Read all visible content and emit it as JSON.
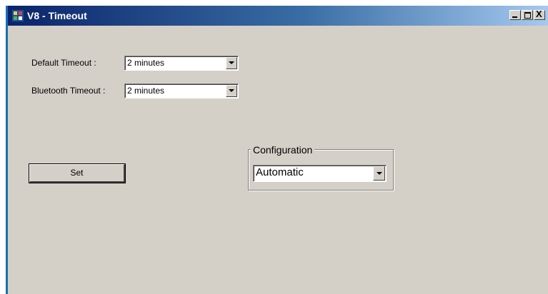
{
  "window": {
    "title": "V8 - Timeout",
    "controls": {
      "minimize": "_",
      "maximize": "□",
      "close": "X"
    }
  },
  "form": {
    "default_timeout_label": "Default Timeout :",
    "default_timeout_value": "2 minutes",
    "bluetooth_timeout_label": "Bluetooth Timeout :",
    "bluetooth_timeout_value": "2 minutes",
    "set_button_label": "Set"
  },
  "configuration": {
    "group_label": "Configuration",
    "selected_value": "Automatic"
  },
  "colors": {
    "window_bg": "#d4d0c8",
    "titlebar_start": "#0a246a",
    "titlebar_end": "#a6caf0"
  },
  "icons": [
    "app-icon",
    "dropdown-arrow-icon",
    "minimize-icon",
    "maximize-icon",
    "close-icon"
  ]
}
